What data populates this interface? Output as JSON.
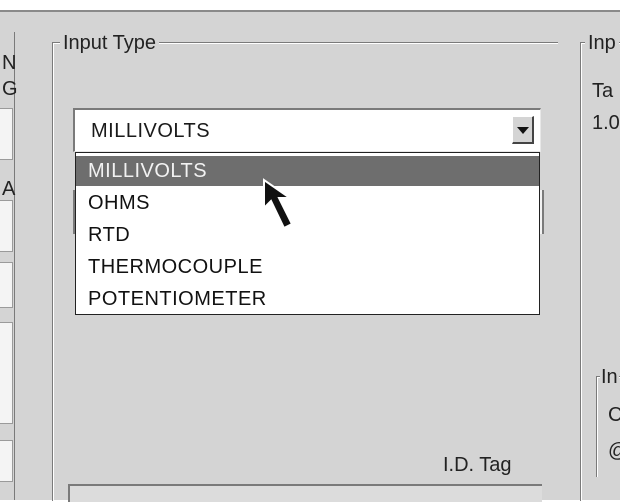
{
  "left_panel": {
    "letters": [
      "N",
      "G",
      "A"
    ]
  },
  "input_type_group": {
    "legend": "Input Type",
    "selected_value": "MILLIVOLTS",
    "options": [
      "MILLIVOLTS",
      "OHMS",
      "RTD",
      "THERMOCOUPLE",
      "POTENTIOMETER"
    ],
    "highlighted_index": 0,
    "id_tag_label": "I.D. Tag"
  },
  "right_panel": {
    "legend": "Inp",
    "line1": "Ta",
    "line2": "1.0",
    "sub_legend": "In",
    "sub_line1": "C",
    "sub_line2": "@"
  },
  "icons": {
    "cursor": "arrow-pointer-icon",
    "dropdown_arrow": "chevron-down-icon"
  },
  "colors": {
    "window_bg": "#d4d4d4",
    "highlight": "#6e6e6e"
  }
}
